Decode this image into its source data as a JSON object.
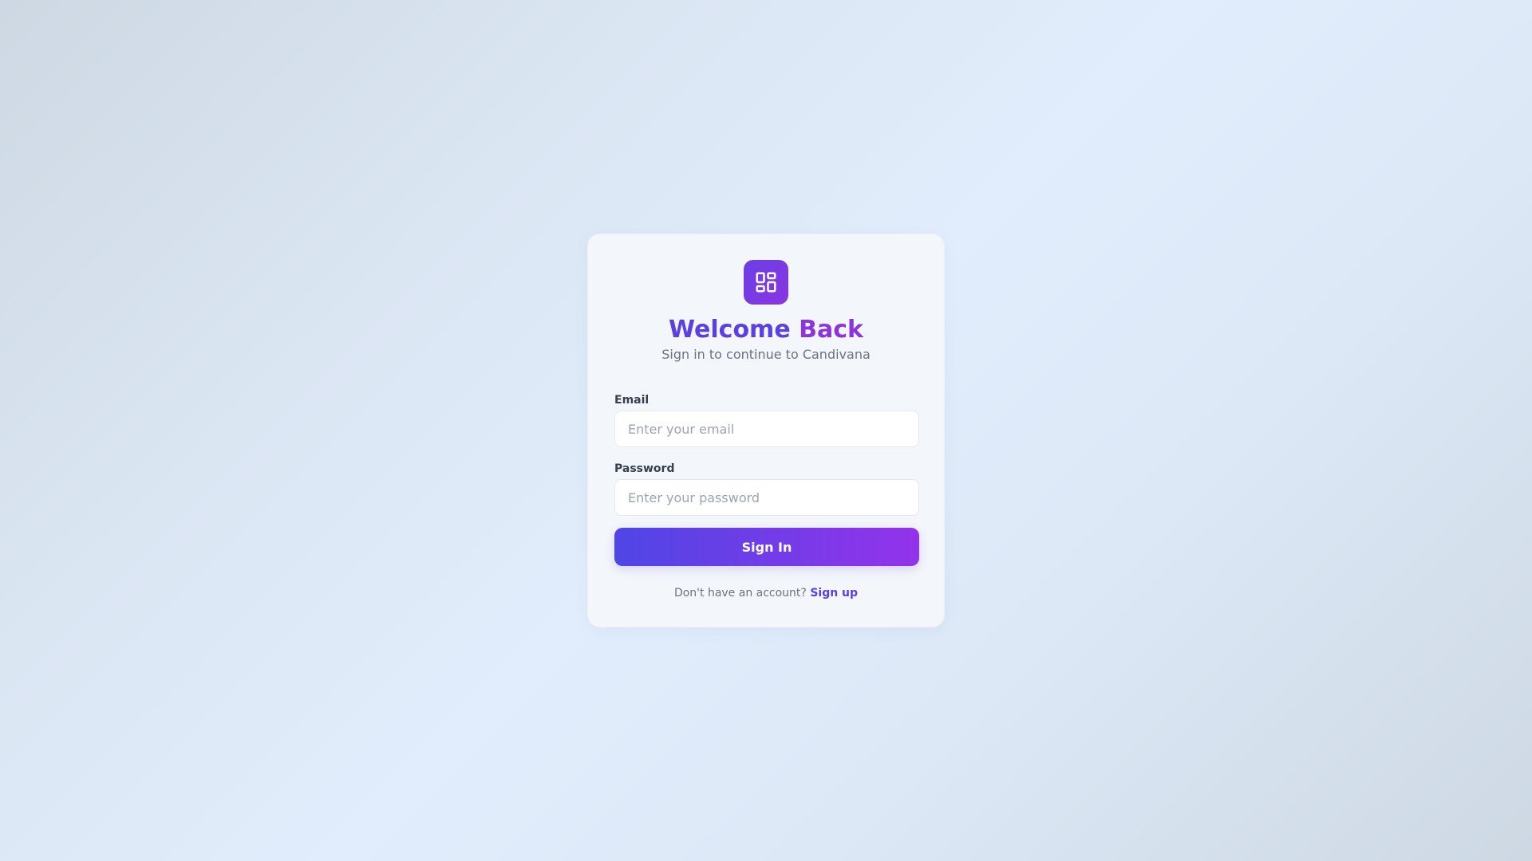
{
  "login": {
    "logo_icon": "dashboard-grid-icon",
    "title_part1": "Welcome",
    "title_part2": "Back",
    "subtitle": "Sign in to continue to Candivana",
    "email_label": "Email",
    "email_placeholder": "Enter your email",
    "email_value": "",
    "password_label": "Password",
    "password_placeholder": "Enter your password",
    "password_value": "",
    "sign_in_label": "Sign In",
    "footer_text": "Don't have an account?",
    "sign_up_label": "Sign up"
  },
  "colors": {
    "accent_indigo": "#4f46e5",
    "accent_purple": "#9333ea",
    "title_indigo": "#5b3fe0",
    "title_purple": "#8b35df"
  }
}
